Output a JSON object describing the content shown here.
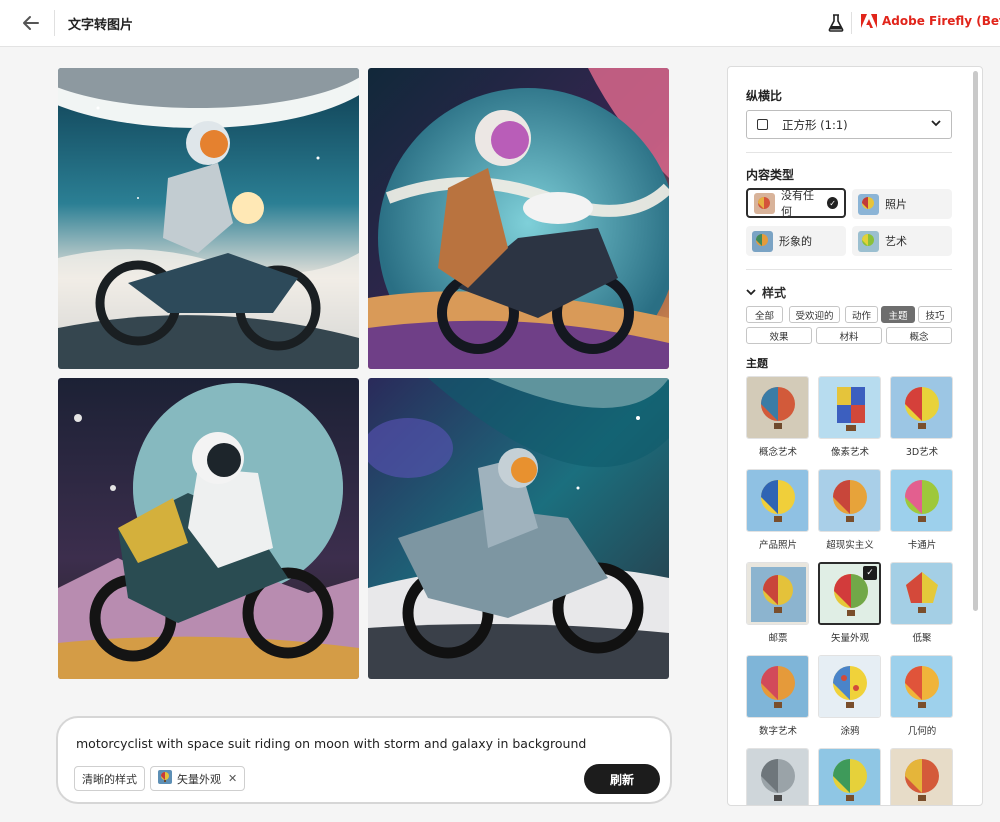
{
  "header": {
    "title": "文字转图片",
    "brand": "Adobe Firefly (Beta)"
  },
  "prompt": {
    "text": "motorcyclist with space suit riding on moon with storm and galaxy in background",
    "chips": [
      {
        "label": "清晰的样式"
      },
      {
        "label": "矢量外观"
      }
    ],
    "refresh_label": "刷新"
  },
  "panel": {
    "aspect_title": "纵横比",
    "aspect_value": "正方形 (1:1)",
    "content_type_title": "内容类型",
    "content_types": [
      {
        "label": "没有任何",
        "selected": true
      },
      {
        "label": "照片",
        "selected": false
      },
      {
        "label": "形象的",
        "selected": false
      },
      {
        "label": "艺术",
        "selected": false
      }
    ],
    "style_title": "样式",
    "style_tags_row1": [
      "全部",
      "受欢迎的",
      "动作",
      "主题",
      "技巧"
    ],
    "style_tags_row2": [
      "效果",
      "材料",
      "概念"
    ],
    "active_tag": "主题",
    "theme_title": "主题",
    "themes": [
      {
        "label": "概念艺术"
      },
      {
        "label": "像素艺术"
      },
      {
        "label": "3D艺术"
      },
      {
        "label": "产品照片"
      },
      {
        "label": "超现实主义"
      },
      {
        "label": "卡通片"
      },
      {
        "label": "邮票"
      },
      {
        "label": "矢量外观",
        "selected": true
      },
      {
        "label": "低聚"
      },
      {
        "label": "数字艺术"
      },
      {
        "label": "涂鸦"
      },
      {
        "label": "几何的"
      },
      {
        "label": ""
      },
      {
        "label": ""
      },
      {
        "label": ""
      }
    ]
  },
  "colors": {
    "brand": "#e1251b",
    "button_dark": "#1c1c1c"
  }
}
